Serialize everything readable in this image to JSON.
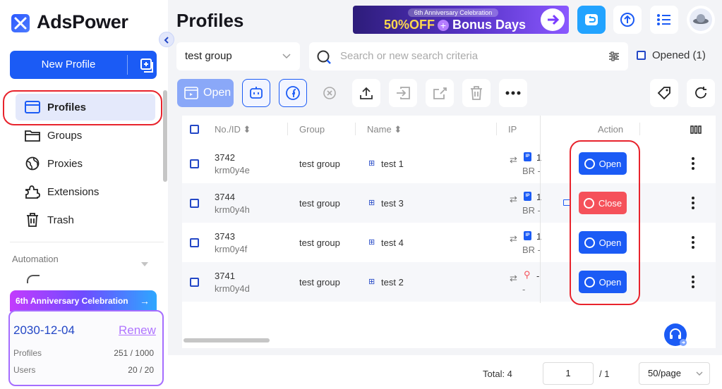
{
  "app": {
    "name": "AdsPower"
  },
  "sidebar": {
    "new_profile_label": "New Profile",
    "items": [
      {
        "label": "Profiles",
        "icon": "profiles-icon"
      },
      {
        "label": "Groups",
        "icon": "folder-icon"
      },
      {
        "label": "Proxies",
        "icon": "globe-icon"
      },
      {
        "label": "Extensions",
        "icon": "puzzle-icon"
      },
      {
        "label": "Trash",
        "icon": "trash-icon"
      }
    ],
    "section_automation": "Automation",
    "promo": {
      "title": "6th Anniversary Celebration",
      "date": "2030-12-04",
      "renew": "Renew",
      "profiles_label": "Profiles",
      "profiles_value": "251 / 1000",
      "users_label": "Users",
      "users_value": "20 / 20"
    }
  },
  "header": {
    "title": "Profiles",
    "banner": {
      "top": "6th Anniversary Celebration",
      "main_a": "50%OFF",
      "main_b": "Bonus Days"
    }
  },
  "filters": {
    "group_value": "test group",
    "search_placeholder": "Search or new search criteria",
    "opened_label": "Opened (1)"
  },
  "toolbar": {
    "open_label": "Open"
  },
  "table": {
    "headers": {
      "id": "No./ID",
      "group": "Group",
      "name": "Name",
      "ip": "IP",
      "action": "Action"
    },
    "rows": [
      {
        "no": "3742",
        "id": "krm0y4e",
        "group": "test group",
        "name": "test 1",
        "ip_a": "1",
        "ip_b": "BR -",
        "action": "Open",
        "state": "closed"
      },
      {
        "no": "3744",
        "id": "krm0y4h",
        "group": "test group",
        "name": "test 3",
        "ip_a": "1",
        "ip_b": "BR -",
        "action": "Close",
        "state": "opened"
      },
      {
        "no": "3743",
        "id": "krm0y4f",
        "group": "test group",
        "name": "test 4",
        "ip_a": "1",
        "ip_b": "BR -",
        "action": "Open",
        "state": "closed"
      },
      {
        "no": "3741",
        "id": "krm0y4d",
        "group": "test group",
        "name": "test 2",
        "ip_a": "-",
        "ip_b": "-",
        "action": "Open",
        "state": "closed"
      }
    ]
  },
  "pagination": {
    "total": "Total: 4",
    "page": "1",
    "of": "/ 1",
    "page_size": "50/page"
  },
  "colors": {
    "accent": "#1b5bf5",
    "danger": "#f5515a",
    "highlight_ring": "#e8232c"
  }
}
